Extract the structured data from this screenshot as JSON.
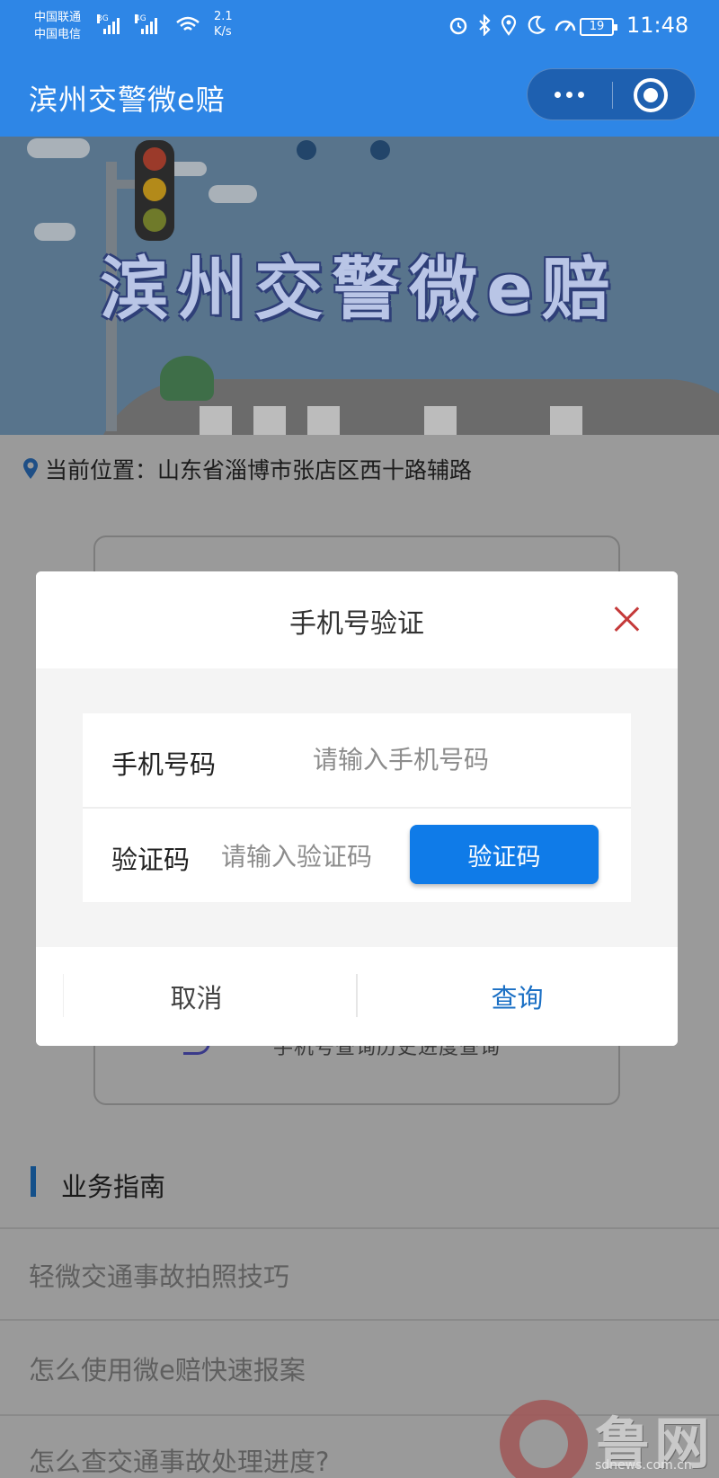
{
  "status_bar": {
    "carrier_1": "中国联通",
    "carrier_2": "中国电信",
    "net_1": "3G",
    "net_2": "4G",
    "speed_value": "2.1",
    "speed_unit": "K/s",
    "battery": "19",
    "time": "11:48",
    "icons": [
      "alarm-icon",
      "bluetooth-icon",
      "location-icon",
      "moon-icon",
      "gauge-icon",
      "battery-icon"
    ]
  },
  "nav": {
    "title": "滨州交警微e赔",
    "icons": [
      "more-dots-icon",
      "close-target-icon"
    ]
  },
  "banner": {
    "title": "滨州交警微e赔"
  },
  "location": {
    "icon": "map-pin-icon",
    "text": "当前位置：山东省淄博市张店区西十路辅路"
  },
  "background_card": {
    "partial_text": "手机号查询历史进度查询"
  },
  "guide": {
    "title": "业务指南",
    "items": [
      "轻微交通事故拍照技巧",
      "怎么使用微e赔快速报案",
      "怎么查交通事故处理进度?"
    ]
  },
  "dialog": {
    "title": "手机号验证",
    "close_icon": "close-icon",
    "phone_label": "手机号码",
    "phone_placeholder": "请输入手机号码",
    "code_label": "验证码",
    "code_placeholder": "请输入验证码",
    "code_button": "验证码",
    "cancel": "取消",
    "query": "查询"
  },
  "watermark": {
    "name": "鲁网",
    "url": "sdnews.com.cn"
  },
  "colors": {
    "primary": "#2e86e6",
    "button_blue": "#0f7be8",
    "close_red": "#c53a3a",
    "query_blue": "#1a6fc4"
  }
}
